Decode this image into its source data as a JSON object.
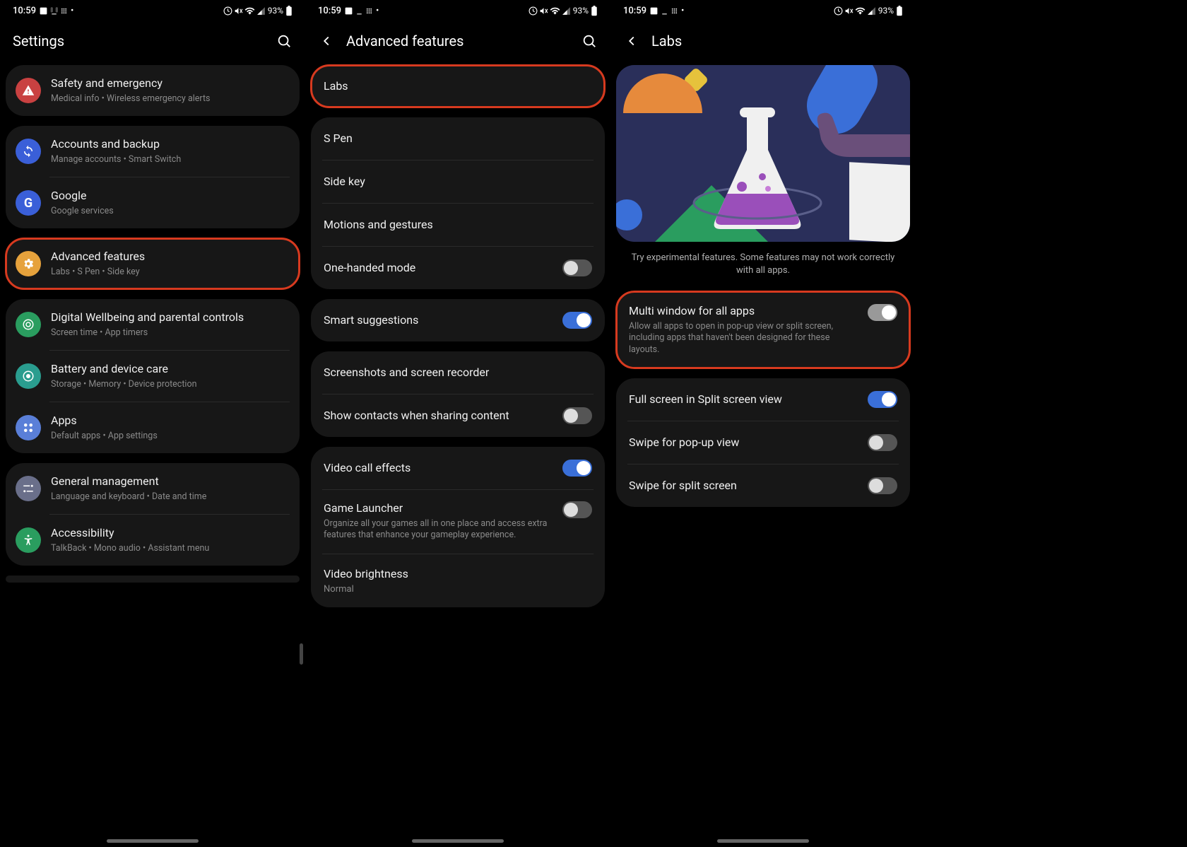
{
  "status": {
    "time": "10:59",
    "battery": "93%"
  },
  "screen1": {
    "title": "Settings",
    "items": [
      {
        "title": "Safety and emergency",
        "sub": "Medical info  •  Wireless emergency alerts"
      },
      {
        "title": "Accounts and backup",
        "sub": "Manage accounts  •  Smart Switch"
      },
      {
        "title": "Google",
        "sub": "Google services"
      },
      {
        "title": "Advanced features",
        "sub": "Labs  •  S Pen  •  Side key"
      },
      {
        "title": "Digital Wellbeing and parental controls",
        "sub": "Screen time  •  App timers"
      },
      {
        "title": "Battery and device care",
        "sub": "Storage  •  Memory  •  Device protection"
      },
      {
        "title": "Apps",
        "sub": "Default apps  •  App settings"
      },
      {
        "title": "General management",
        "sub": "Language and keyboard  •  Date and time"
      },
      {
        "title": "Accessibility",
        "sub": "TalkBack  •  Mono audio  •  Assistant menu"
      }
    ]
  },
  "screen2": {
    "title": "Advanced features",
    "items": [
      {
        "title": "Labs"
      },
      {
        "title": "S Pen"
      },
      {
        "title": "Side key"
      },
      {
        "title": "Motions and gestures"
      },
      {
        "title": "One-handed mode",
        "toggle": "off"
      },
      {
        "title": "Smart suggestions",
        "toggle": "on"
      },
      {
        "title": "Screenshots and screen recorder"
      },
      {
        "title": "Show contacts when sharing content",
        "toggle": "off"
      },
      {
        "title": "Video call effects",
        "toggle": "on"
      },
      {
        "title": "Game Launcher",
        "sub": "Organize all your games all in one place and access extra features that enhance your gameplay experience.",
        "toggle": "off"
      },
      {
        "title": "Video brightness",
        "value": "Normal"
      }
    ]
  },
  "screen3": {
    "title": "Labs",
    "desc": "Try experimental features. Some features may not work correctly with all apps.",
    "items": [
      {
        "title": "Multi window for all apps",
        "sub": "Allow all apps to open in pop-up view or split screen, including apps that haven't been designed for these layouts.",
        "toggle": "on-grey"
      },
      {
        "title": "Full screen in Split screen view",
        "toggle": "on"
      },
      {
        "title": "Swipe for pop-up view",
        "toggle": "off"
      },
      {
        "title": "Swipe for split screen",
        "toggle": "off"
      }
    ]
  }
}
